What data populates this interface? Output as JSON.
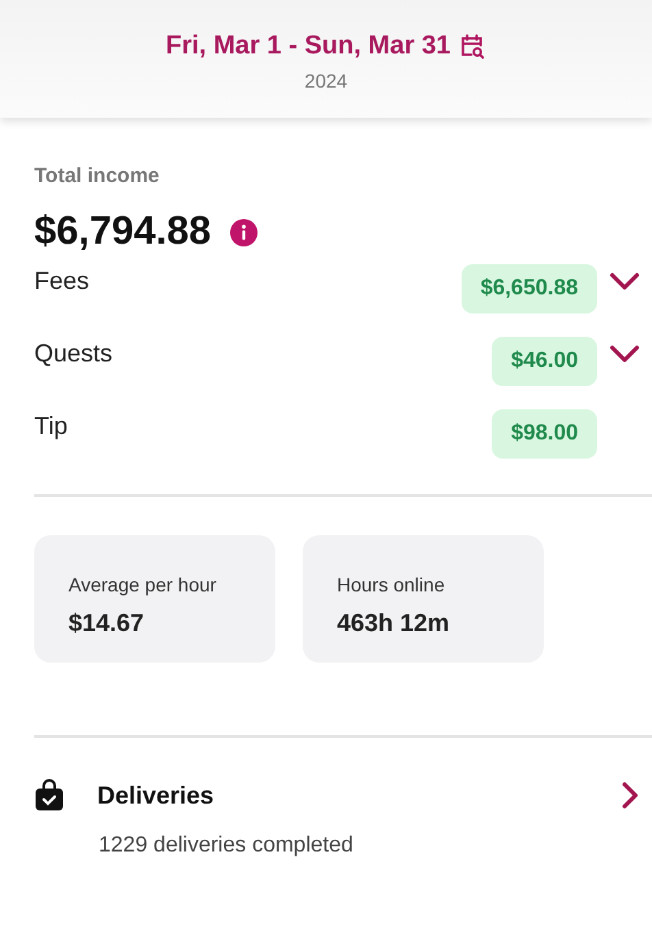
{
  "header": {
    "date_range": "Fri, Mar 1 - Sun, Mar 31",
    "year": "2024"
  },
  "total": {
    "label": "Total income",
    "amount": "$6,794.88"
  },
  "breakdown": [
    {
      "label": "Fees",
      "amount": "$6,650.88",
      "kind": "expandable"
    },
    {
      "label": "Quests",
      "amount": "$46.00",
      "kind": "expandable"
    },
    {
      "label": "Tip",
      "amount": "$98.00",
      "kind": "plain"
    }
  ],
  "stats": [
    {
      "label": "Average per hour",
      "value": "$14.67"
    },
    {
      "label": "Hours online",
      "value": "463h 12m"
    }
  ],
  "deliveries": {
    "title": "Deliveries",
    "subtitle": "1229 deliveries completed"
  }
}
